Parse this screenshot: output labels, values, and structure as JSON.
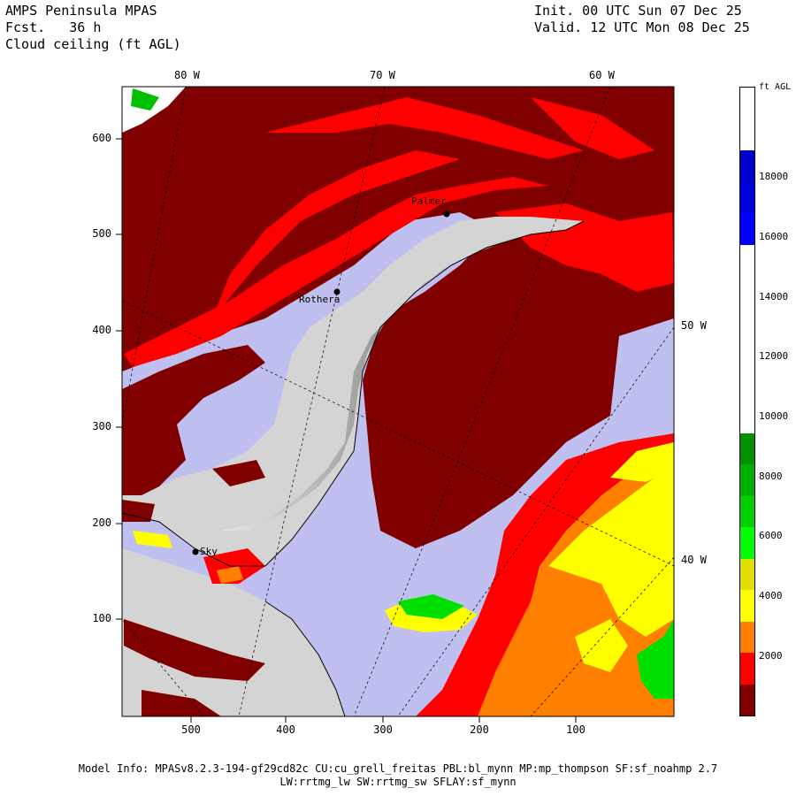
{
  "header": {
    "model": "AMPS Peninsula MPAS",
    "fcst": "Fcst.   36 h",
    "field": "Cloud ceiling (ft AGL)",
    "init": "Init. 00 UTC Sun 07 Dec 25",
    "valid": "Valid. 12 UTC Mon 08 Dec 25"
  },
  "map": {
    "top_lon_labels": [
      "80 W",
      "70 W",
      "60 W"
    ],
    "side_lon_labels": [
      "50 W",
      "40 W"
    ],
    "y_ticks": [
      "600",
      "500",
      "400",
      "300",
      "200",
      "100"
    ],
    "x_ticks": [
      "500",
      "400",
      "300",
      "200",
      "100"
    ],
    "stations": [
      "Palmer",
      "Rothera",
      "Sky"
    ],
    "colors": {
      "ocean": "#c0c0f0",
      "land": "#d4d4d4",
      "darkred": "#800000",
      "red": "#ff0000",
      "orange": "#ff8000",
      "yellow": "#ffff00",
      "green": "#00e000"
    }
  },
  "legend": {
    "title": "ft AGL",
    "ticks": [
      "18000",
      "16000",
      "14000",
      "12000",
      "10000",
      "8000",
      "6000",
      "4000",
      "2000"
    ],
    "bins": [
      {
        "color": "#800000"
      },
      {
        "color": "#ff0000"
      },
      {
        "color": "#ff8000"
      },
      {
        "color": "#ffff00"
      },
      {
        "color": "#e0e000"
      },
      {
        "color": "#00ff00"
      },
      {
        "color": "#00d000"
      },
      {
        "color": "#00b000"
      },
      {
        "color": "#009000"
      },
      {
        "color": "#ffffff"
      },
      {
        "color": "#ffffff"
      },
      {
        "color": "#ffffff"
      },
      {
        "color": "#ffffff"
      },
      {
        "color": "#ffffff"
      },
      {
        "color": "#ffffff"
      },
      {
        "color": "#0000ff"
      },
      {
        "color": "#0000dd"
      },
      {
        "color": "#0000cc"
      },
      {
        "color": "#ffffff"
      },
      {
        "color": "#ffffff"
      }
    ]
  },
  "footer": {
    "line1": "Model Info: MPASv8.2.3-194-gf29cd82c CU:cu_grell_freitas PBL:bl_mynn MP:mp_thompson SF:sf_noahmp 2.7",
    "line2": "LW:rrtmg_lw SW:rrtmg_sw SFLAY:sf_mynn"
  }
}
